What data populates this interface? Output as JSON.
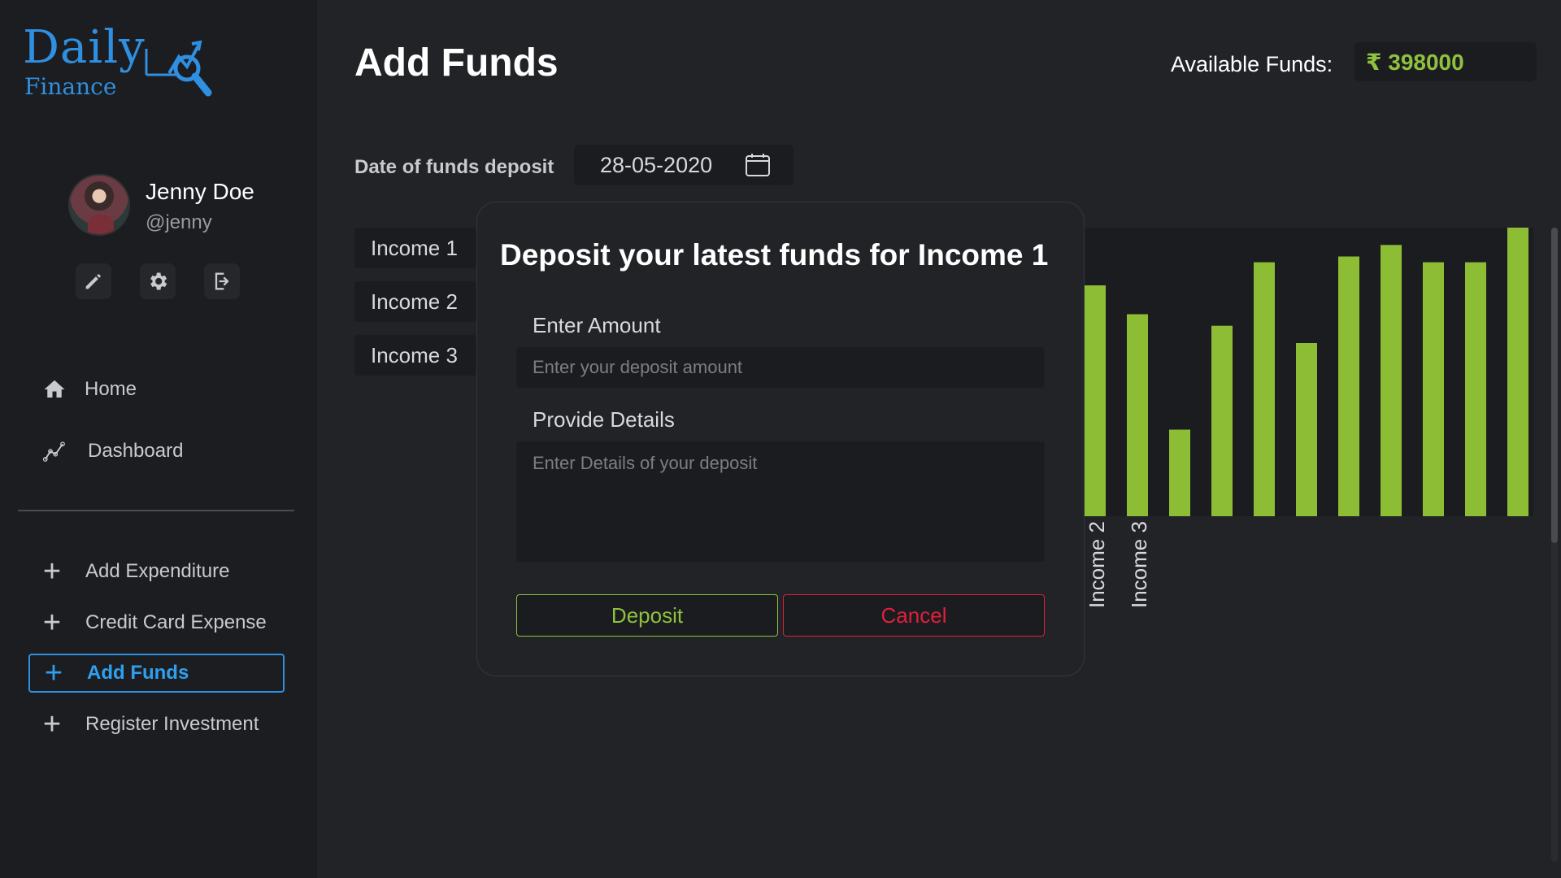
{
  "brand": {
    "name": "Daily",
    "sub": "Finance"
  },
  "user": {
    "name": "Jenny Doe",
    "handle": "@jenny"
  },
  "user_actions": [
    "edit-icon",
    "gear-icon",
    "logout-icon"
  ],
  "nav": [
    {
      "label": "Home",
      "icon": "home-icon"
    },
    {
      "label": "Dashboard",
      "icon": "chart-line-icon"
    }
  ],
  "actions": [
    {
      "label": "Add Expenditure",
      "active": false
    },
    {
      "label": "Credit Card Expense",
      "active": false
    },
    {
      "label": "Add Funds",
      "active": true
    },
    {
      "label": "Register Investment",
      "active": false
    }
  ],
  "page": {
    "title": "Add Funds",
    "funds_label": "Available Funds:",
    "funds_value": "₹ 398000",
    "date_label": "Date of funds deposit",
    "date_value": "28-05-2020"
  },
  "income_tabs": [
    "Income 1",
    "Income 2",
    "Income 3"
  ],
  "modal": {
    "title": "Deposit your latest funds for Income 1",
    "amount_label": "Enter Amount",
    "amount_placeholder": "Enter your deposit amount",
    "details_label": "Provide Details",
    "details_placeholder": "Enter Details of your deposit",
    "deposit_label": "Deposit",
    "cancel_label": "Cancel"
  },
  "colors": {
    "accent": "#2f8fe0",
    "positive": "#8fc13f",
    "danger": "#e0203c",
    "bar": "#8dbd35"
  },
  "chart_data": {
    "type": "bar",
    "categories": [
      "Income 2",
      "Income 3"
    ],
    "visible_tick_labels": [
      "Income 2",
      "Income 3"
    ],
    "values": [
      80,
      70,
      30,
      66,
      88,
      60,
      90,
      94,
      88,
      88,
      100
    ],
    "ylim": [
      0,
      100
    ]
  }
}
